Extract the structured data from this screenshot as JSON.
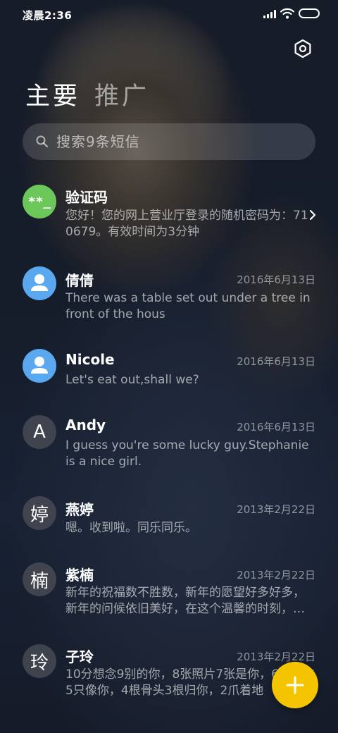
{
  "status_bar": {
    "time": "凌晨2:36",
    "icons": [
      "signal-icon",
      "wifi-icon",
      "battery-icon"
    ]
  },
  "header": {
    "settings_icon": "gear-icon",
    "tabs": [
      {
        "label": "主要",
        "active": true
      },
      {
        "label": "推广",
        "active": false
      }
    ]
  },
  "search": {
    "placeholder": "搜索9条短信",
    "value": ""
  },
  "conversations": [
    {
      "avatar": "**_",
      "avatar_type": "code",
      "name": "验证码",
      "date": "",
      "preview": "您好！您的网上营业厅登录的随机密码为：710679。有效时间为3分钟",
      "chevron": true
    },
    {
      "avatar": "",
      "avatar_type": "contact",
      "name": "倩倩",
      "date": "2016年6月13日",
      "preview": "There was a table set out under a tree in front of the hous"
    },
    {
      "avatar": "",
      "avatar_type": "contact",
      "name": "Nicole",
      "date": "2016年6月13日",
      "preview": "Let's eat out,shall we?"
    },
    {
      "avatar": "A",
      "avatar_type": "letter",
      "name": "Andy",
      "date": "2016年6月13日",
      "preview": "I guess you're some lucky guy.Stephanie is a nice girl."
    },
    {
      "avatar": "婷",
      "avatar_type": "letter",
      "name": "燕婷",
      "date": "2013年2月22日",
      "preview": "嗯。收到啦。同乐同乐。"
    },
    {
      "avatar": "楠",
      "avatar_type": "letter",
      "name": "紫楠",
      "date": "2013年2月22日",
      "preview": "新年的祝福数不胜数，新年的愿望好多好多，新年的问候依旧美好，在这个温馨的时刻，…"
    },
    {
      "avatar": "玲",
      "avatar_type": "letter",
      "name": "子玲",
      "date": "2013年2月22日",
      "preview": "10分想念9别的你，8张照片7张是你，6条短信5只像你，4根骨头3根归你，2爪着地"
    }
  ],
  "fab": {
    "icon": "plus-icon"
  },
  "colors": {
    "fab": "#f5c400",
    "code_avatar": "#6cc75a",
    "contact_avatar": "#5aa8f0",
    "letter_avatar": "#464a54"
  }
}
